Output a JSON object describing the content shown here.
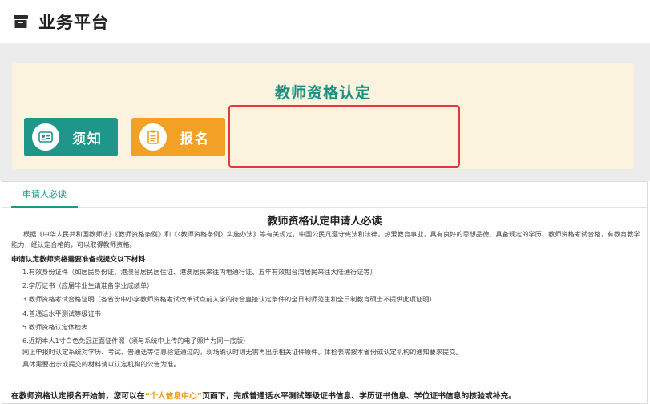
{
  "header": {
    "title": "业务平台"
  },
  "banner": {
    "title": "教师资格认定",
    "notice_label": "须知",
    "signup_label": "报名"
  },
  "tabs": {
    "active_label": "申请人必读"
  },
  "content": {
    "title": "教师资格认定申请人必读",
    "intro": "根据《中华人民共和国教师法》《教师资格条例》和《〈教师资格条例〉实施办法》等有关规定，中国公民凡遵守宪法和法律，热爱教育事业，具有良好的思想品德，具备规定的学历、教师资格考试合格，有教育教学能力，经认定合格的，可以取得教师资格。",
    "list_heading": "申请认定教师资格需要准备或提交以下材料",
    "items": [
      "1.有效身份证件（如居民身份证、港澳台居民居住证、港澳居民来往内地通行证、五年有效期台湾居民来往大陆通行证等）",
      "2.学历证书（应届毕业生请准备学业成绩单）",
      "3.教师资格考试合格证明（各省份中小学教师资格考试改革试点前入学的符合直接认定条件的全日制师范生和全日制教育硕士不提供此项证明）",
      "4.普通话水平测试等级证书",
      "5.教师资格认定体检表",
      "6.近期本人1寸白色免冠正面证件照（须与系统中上传的电子照片为同一底版）"
    ],
    "note1": "网上申报时认定系统对学历、考试、普通话等信息验证通过的，现场确认时则无需再出示相关证件原件。体检表需按本省份或认定机构的通知要求提交。",
    "note2": "具体需要出示或提交的材料请以认定机构的公告为准。",
    "bottom_before": "在教师资格认定报名开始前，您可以在",
    "bottom_highlight": "“个人信息中心”",
    "bottom_after": "页面下，完成普通话水平测试等级证书信息、学历证书信息、学位证书信息的核验或补充。"
  },
  "colors": {
    "primary_green": "#1e978a",
    "primary_orange": "#f3a027",
    "highlight_red": "#e23a3a",
    "banner_bg": "#fbf3dd"
  },
  "icons": {
    "header": "archive-box-icon",
    "notice": "id-card-icon",
    "signup": "clipboard-icon"
  }
}
